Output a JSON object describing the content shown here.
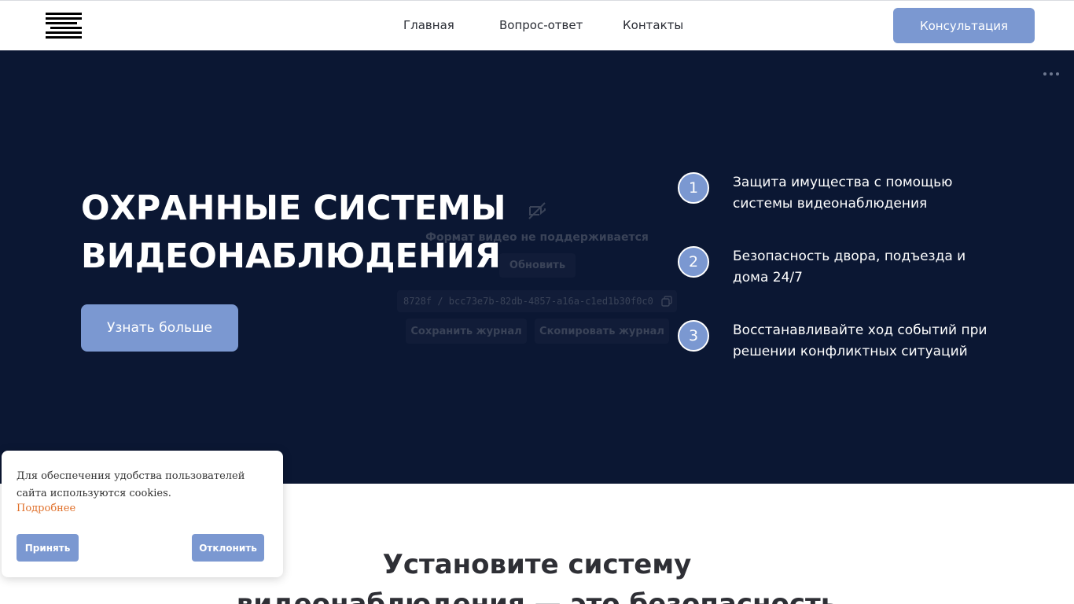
{
  "header": {
    "nav": [
      "Главная",
      "Вопрос-ответ",
      "Контакты"
    ],
    "cta_label": "Консультация"
  },
  "hero": {
    "title_line1": "ОХРАННЫЕ СИСТЕМЫ",
    "title_line2": "ВИДЕОНАБЛЮДЕНИЯ",
    "button_label": "Узнать больше",
    "features": [
      {
        "num": "1",
        "text": "Защита имущества с помощью системы видеонаблюдения"
      },
      {
        "num": "2",
        "text": "Безопасность двора, подъезда и дома 24/7"
      },
      {
        "num": "3",
        "text": "Восстанавливайте ход событий при решении конфликтных ситуаций"
      }
    ]
  },
  "video_error": {
    "message": "Формат видео не поддерживается",
    "refresh_label": "Обновить",
    "id": "8728f / bcc73e7b-82db-4857-a16a-c1ed1b30f0c0",
    "save_log_label": "Сохранить журнал",
    "copy_log_label": "Скопировать журнал"
  },
  "section": {
    "title_line1": "Установите систему",
    "title_line2": "видеонаблюдения — это безопасность"
  },
  "cookie": {
    "text": "Для обеспечения удобства пользователей сайта используются cookies.",
    "link": "Подробнее",
    "accept": "Принять",
    "decline": "Отклонить"
  },
  "colors": {
    "accent": "#7b98d1",
    "hero_bg": "#0b1733",
    "link": "#e0702a"
  }
}
